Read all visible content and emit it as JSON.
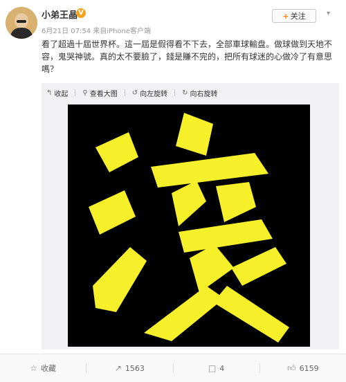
{
  "post": {
    "author": "小弟王晶",
    "follow_label": "关注",
    "meta": {
      "time": "6月21日 07:54",
      "source_prefix": "来自",
      "source": "iPhone客户端"
    },
    "text": "看了超過十屆世界杯。這一屆是假得看不下去，全部車球輸盘。做球做到天地不容，鬼哭神號。真的太不要臉了，錢是賺不完的，把所有球迷的心做冷了有意思嗎？",
    "image_char": "滚",
    "toolbar": {
      "collapse": "收起",
      "view_large": "查看大图",
      "rotate_left": "向左旋转",
      "rotate_right": "向右旋转"
    }
  },
  "actions": {
    "favorite": "收藏",
    "repost": "1563",
    "comment": "4",
    "like": "6159"
  },
  "colors": {
    "accent_orange": "#ff8200",
    "image_bg": "#000000",
    "image_glyph": "#f5f02a"
  }
}
